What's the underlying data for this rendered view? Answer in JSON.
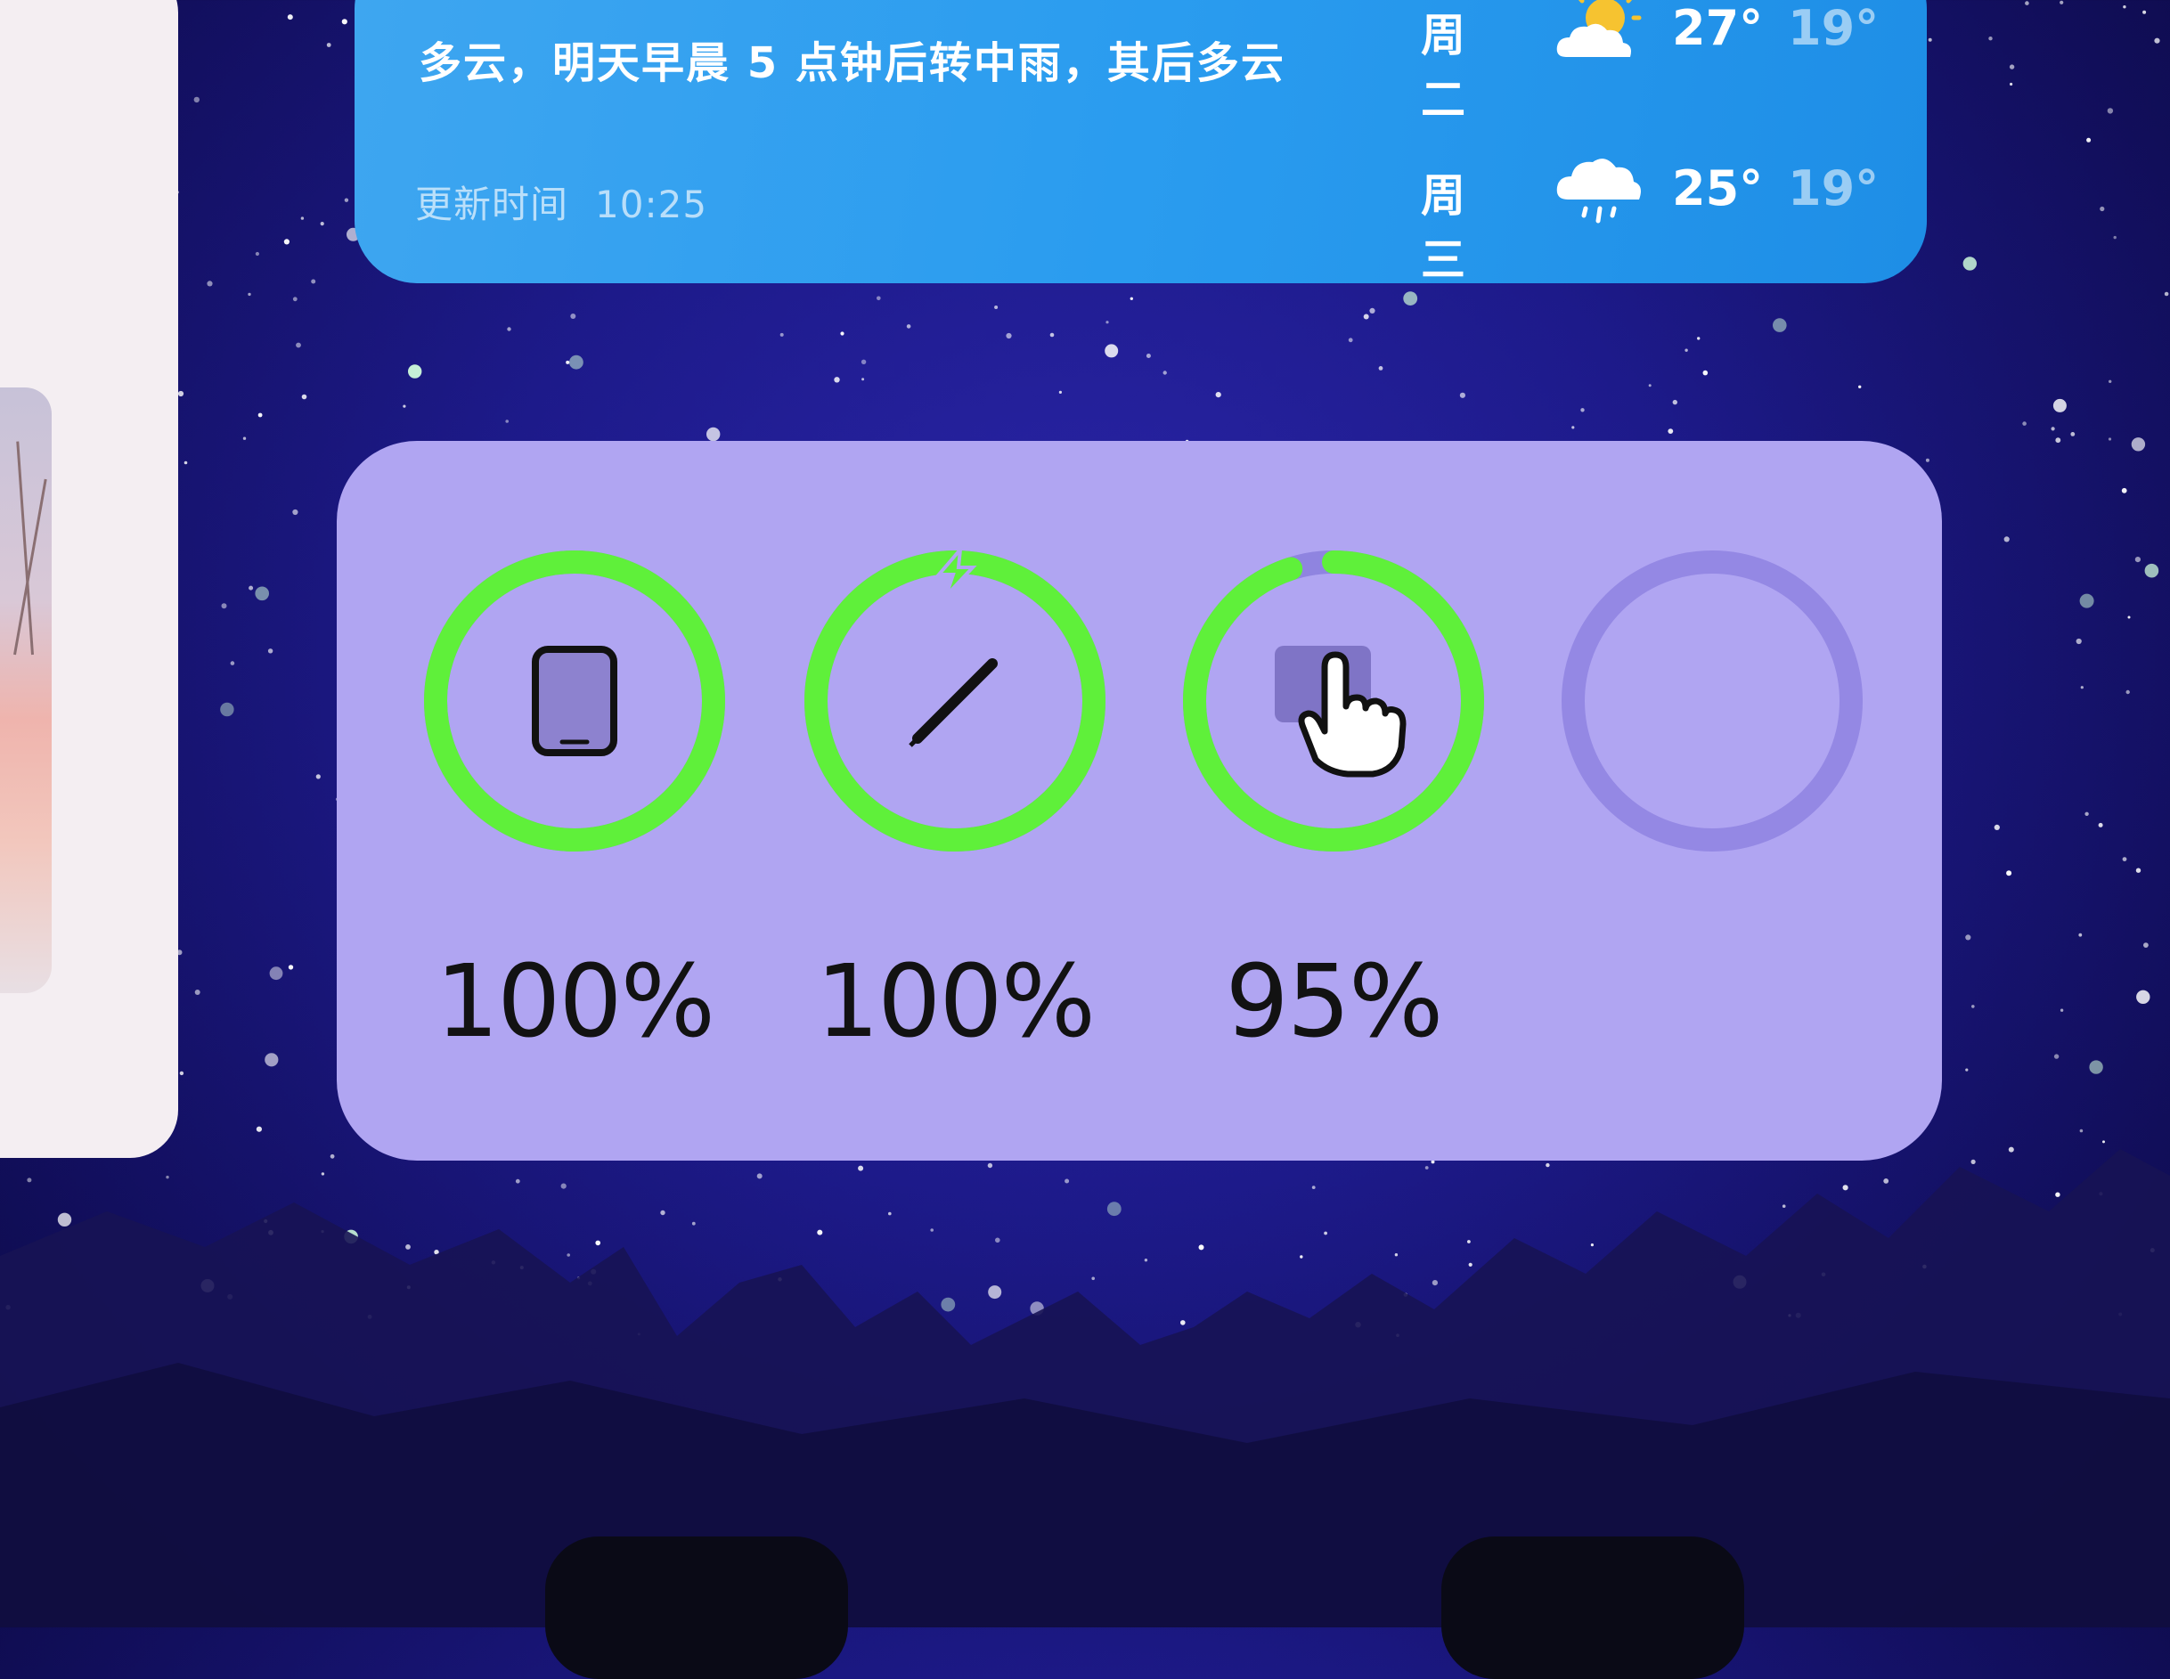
{
  "weather_widget": {
    "description": "多云，明天早晨 5 点钟后转中雨，其后多云",
    "updated_label": "更新时间",
    "updated_time": "10:25",
    "forecast": [
      {
        "day": "周二",
        "icon": "partly-cloudy-icon",
        "high": "27°",
        "low": "19°"
      },
      {
        "day": "周三",
        "icon": "rain-cloud-icon",
        "high": "25°",
        "low": "19°"
      }
    ]
  },
  "battery_widget": {
    "devices": [
      {
        "name": "ipad",
        "icon": "tablet-icon",
        "level": 1.0,
        "label": "100%",
        "charging": false
      },
      {
        "name": "apple-pencil",
        "icon": "pencil-icon",
        "level": 1.0,
        "label": "100%",
        "charging": true
      },
      {
        "name": "pointer-device",
        "icon": "hand-pointer-icon",
        "level": 0.95,
        "label": "95%",
        "charging": false
      },
      {
        "name": "empty-slot",
        "icon": "",
        "level": 0,
        "label": "",
        "charging": false
      }
    ],
    "colors": {
      "ring_fill": "#5ff03a",
      "ring_track": "#8f84e0",
      "background": "#b0a5f2"
    }
  }
}
